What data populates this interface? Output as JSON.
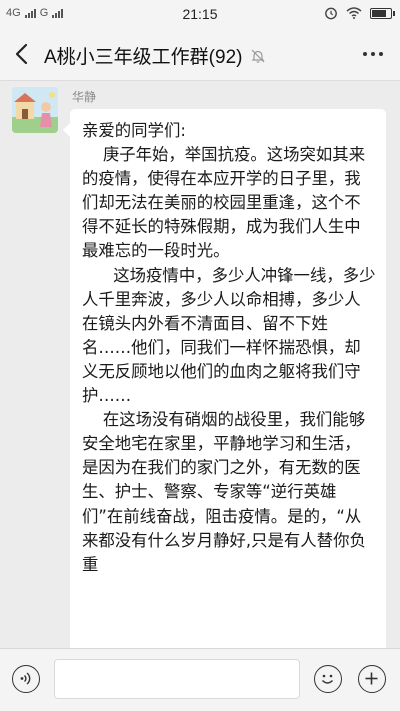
{
  "status_bar": {
    "network_left": "4G",
    "network_right": "G",
    "time": "21:15",
    "icons": [
      "signal-icon",
      "alarm-icon",
      "wifi-icon",
      "battery-icon"
    ],
    "battery_level": 0.85
  },
  "header": {
    "title": "A桃小三年级工作群(92)",
    "icons": [
      "back-arrow-icon",
      "mute-bell-icon",
      "more-dots-icon"
    ]
  },
  "message": {
    "sender": "华静",
    "paragraphs": [
      "亲爱的同学们:",
      "    庚子年始，举国抗疫。这场突如其来的疫情，使得在本应开学的日子里，我们却无法在美丽的校园里重逢，这个不得不延长的特殊假期，成为我们人生中最难忘的一段时光。",
      "      这场疫情中，多少人冲锋一线，多少人千里奔波，多少人以命相搏，多少人在镜头内外看不清面目、留不下姓名……他们，同我们一样怀揣恐惧，却义无反顾地以他们的血肉之躯将我们守护……",
      "    在这场没有硝烟的战役里，我们能够安全地宅在家里，平静地学习和生活，是因为在我们的家门之外，有无数的医生、护士、警察、专家等“逆行英雄们”在前线奋战，阻击疫情。是的，“从来都没有什么岁月静好,只是有人替你负重"
    ]
  },
  "input_bar": {
    "icons": [
      "voice-icon",
      "emoji-icon",
      "plus-icon"
    ]
  },
  "colors": {
    "background": "#ececec",
    "bar": "#f4f4f4",
    "bubble": "#ffffff",
    "sender_text": "#8a8a8a"
  }
}
